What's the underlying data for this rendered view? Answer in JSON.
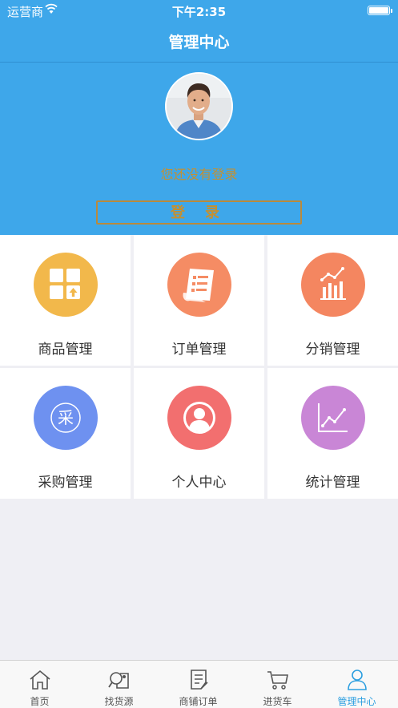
{
  "status_bar": {
    "carrier": "运营商",
    "time": "下午2:35"
  },
  "header": {
    "title": "管理中心"
  },
  "profile": {
    "login_hint": "您还没有登录",
    "login_button": "登 录"
  },
  "menu": [
    {
      "label": "商品管理",
      "icon": "goods-icon",
      "color": "#f2b84b"
    },
    {
      "label": "订单管理",
      "icon": "order-icon",
      "color": "#f58c64"
    },
    {
      "label": "分销管理",
      "icon": "distribution-icon",
      "color": "#f48660"
    },
    {
      "label": "采购管理",
      "icon": "purchase-icon",
      "color": "#6e91f0"
    },
    {
      "label": "个人中心",
      "icon": "personal-icon",
      "color": "#f26f6f"
    },
    {
      "label": "统计管理",
      "icon": "statistics-icon",
      "color": "#c986d6"
    }
  ],
  "tabbar": [
    {
      "label": "首页",
      "icon": "home-icon",
      "active": false
    },
    {
      "label": "找货源",
      "icon": "find-source-icon",
      "active": false
    },
    {
      "label": "商铺订单",
      "icon": "shop-order-icon",
      "active": false
    },
    {
      "label": "进货车",
      "icon": "cart-icon",
      "active": false
    },
    {
      "label": "管理中心",
      "icon": "user-icon",
      "active": true
    }
  ],
  "colors": {
    "header": "#3ea7ea",
    "accent_gold": "#c49032",
    "tab_active": "#2c9fe0"
  }
}
